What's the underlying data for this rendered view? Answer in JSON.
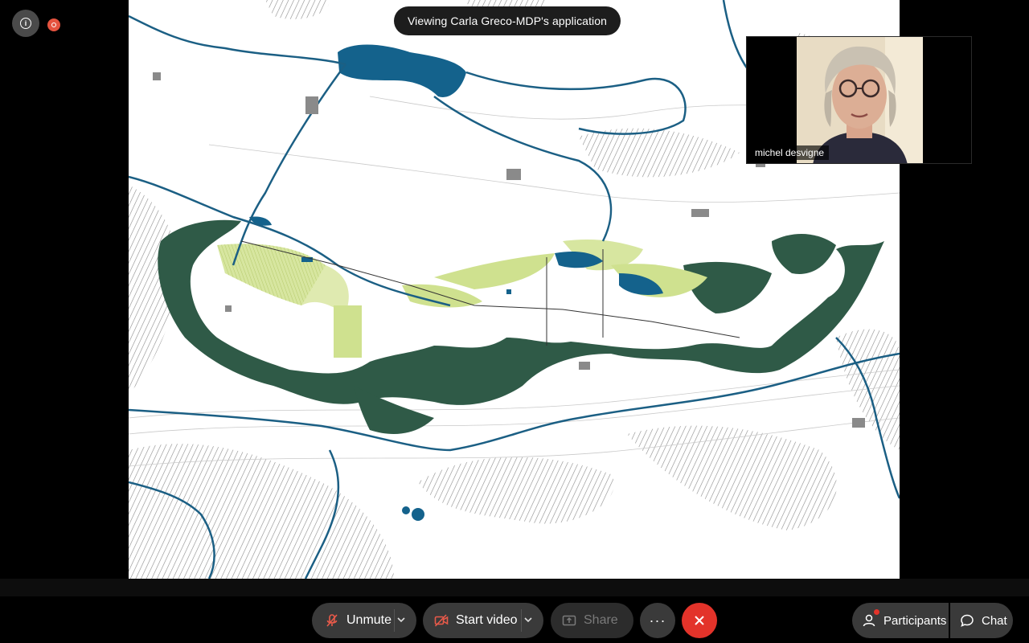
{
  "window": {
    "viewing_label": "Viewing Carla Greco-MDP's application"
  },
  "participant_video": {
    "name": "michel desvigne"
  },
  "toolbar": {
    "unmute_label": "Unmute",
    "start_video_label": "Start video",
    "share_label": "Share",
    "more_label": "···",
    "participants_label": "Participants",
    "chat_label": "Chat"
  },
  "colors": {
    "water": "#14628c",
    "forest": "#2f5a47",
    "fields": "#cfe18f",
    "leave": "#e3332a",
    "record": "#e5533f"
  },
  "icons": [
    "info-icon",
    "record-icon",
    "microphone-muted-icon",
    "video-off-icon",
    "share-screen-icon",
    "more-icon",
    "close-icon",
    "participants-icon",
    "chat-icon",
    "chevron-down-icon"
  ]
}
